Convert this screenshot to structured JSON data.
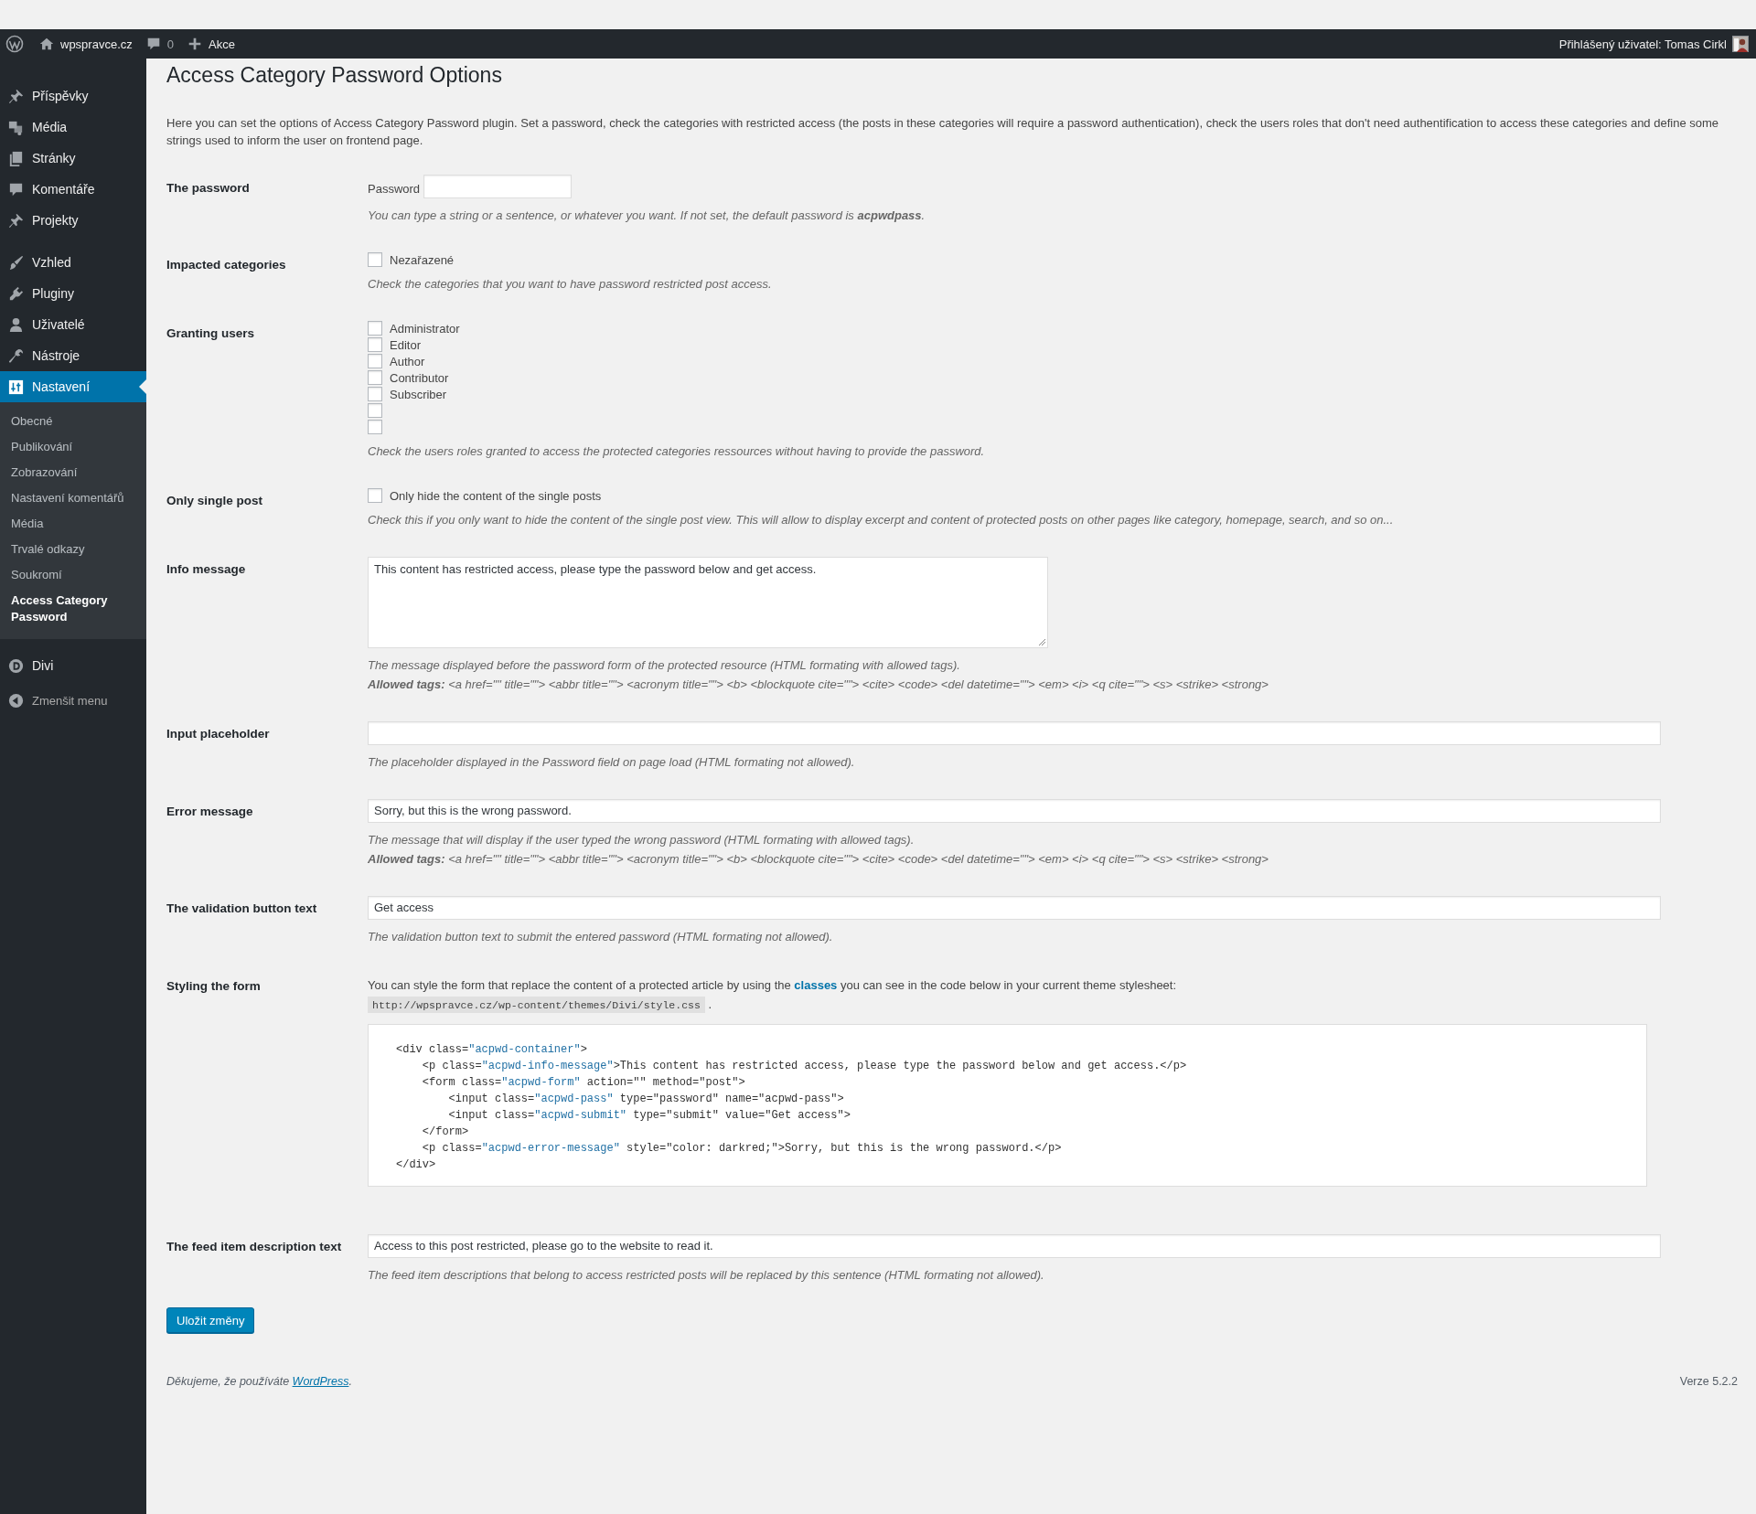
{
  "admin_bar": {
    "site": "wpspravce.cz",
    "comments": "0",
    "new": "Akce",
    "user": "Přihlášený uživatel: Tomas Cirkl"
  },
  "sidebar": {
    "groups": [
      [
        {
          "label": "Příspěvky",
          "kind": "pin",
          "selected": false
        },
        {
          "label": "Média",
          "kind": "media",
          "selected": false
        },
        {
          "label": "Stránky",
          "kind": "pages",
          "selected": false
        },
        {
          "label": "Komentáře",
          "kind": "comment",
          "selected": false
        },
        {
          "label": "Projekty",
          "kind": "pin",
          "selected": false
        }
      ],
      [
        {
          "label": "Vzhled",
          "kind": "brush",
          "selected": false
        },
        {
          "label": "Pluginy",
          "kind": "plug",
          "selected": false
        },
        {
          "label": "Uživatelé",
          "kind": "user",
          "selected": false
        },
        {
          "label": "Nástroje",
          "kind": "wrench",
          "selected": false
        },
        {
          "label": "Nastavení",
          "kind": "settings",
          "selected": true,
          "children": [
            {
              "label": "Obecné",
              "selected": false
            },
            {
              "label": "Publikování",
              "selected": false
            },
            {
              "label": "Zobrazování",
              "selected": false
            },
            {
              "label": "Nastavení komentářů",
              "selected": false
            },
            {
              "label": "Média",
              "selected": false
            },
            {
              "label": "Trvalé odkazy",
              "selected": false
            },
            {
              "label": "Soukromí",
              "selected": false
            },
            {
              "label": "Access Category Password",
              "selected": true
            }
          ]
        }
      ],
      [
        {
          "label": "Divi",
          "kind": "divi",
          "selected": false
        }
      ]
    ],
    "collapse": "Zmenšit menu"
  },
  "page": {
    "title": "Access Category Password Options",
    "intro": "Here you can set the options of Access Category Password plugin. Set a password, check the categories with restricted access (the posts in these categories will require a password authentication), check the users roles that don't need authentification to access these categories and define some strings used to inform the user on frontend page.",
    "fields": [
      {
        "kind": "password",
        "label": "The password",
        "field_label": "Password",
        "description": "You can type a string or a sentence, or whatever you want. If not set, the default password is **acpwdpass**."
      },
      {
        "kind": "checkboxes",
        "label": "Impacted categories",
        "options": [
          {
            "label": "Nezařazené",
            "checked": false
          }
        ],
        "description": "Check the categories that you want to have password restricted post access."
      },
      {
        "kind": "checkboxes",
        "label": "Granting users",
        "options": [
          {
            "label": "Administrator",
            "checked": false
          },
          {
            "label": "Editor",
            "checked": false
          },
          {
            "label": "Author",
            "checked": false
          },
          {
            "label": "Contributor",
            "checked": false
          },
          {
            "label": "Subscriber",
            "checked": false
          },
          {
            "checked": false
          },
          {
            "checked": false
          }
        ],
        "description": "Check the users roles granted to access the protected categories ressources without having to provide the password."
      },
      {
        "kind": "checkboxes",
        "label": "Only single post",
        "options": [
          {
            "label": "Only hide the content of the single posts",
            "checked": false
          }
        ],
        "description": "Check this if you only want to hide the content of the single post view. This will allow to display excerpt and content of protected posts on other pages like category, homepage, search, and so on..."
      },
      {
        "kind": "textarea",
        "label": "Info message",
        "value": "This content has restricted access, please type the password below and get access.",
        "description": "The message displayed before the password form of the protected resource (HTML formating with allowed tags).",
        "allowed_tags": "**Allowed tags:** <a href=\"\" title=\"\"> <abbr title=\"\"> <acronym title=\"\"> <b> <blockquote cite=\"\"> <cite> <code> <del datetime=\"\"> <em> <i> <q cite=\"\"> <s> <strike> <strong>"
      },
      {
        "kind": "text",
        "label": "Input placeholder",
        "description": "The placeholder displayed in the Password field on page load (HTML formating not allowed)."
      },
      {
        "kind": "text",
        "label": "Error message",
        "value": "Sorry, but this is the wrong password.",
        "description": "The message that will display if the user typed the wrong password (HTML formating with allowed tags).",
        "allowed_tags": "**Allowed tags:** <a href=\"\" title=\"\"> <abbr title=\"\"> <acronym title=\"\"> <b> <blockquote cite=\"\"> <cite> <code> <del datetime=\"\"> <em> <i> <q cite=\"\"> <s> <strike> <strong>"
      },
      {
        "kind": "text",
        "label": "The validation button text",
        "value": "Get access",
        "description": "The validation button text to submit the entered password (HTML formating not allowed)."
      },
      {
        "kind": "styling",
        "label": "Styling the form",
        "text_before": "You can style the form that replace the content of a protected article by using the ",
        "link": "classes",
        "text_after": " you can see in the code below in your current theme stylesheet:",
        "stylesheet_url": "http://wpspravce.cz/wp-content/themes/Divi/style.css",
        "url_suffix": " .",
        "code_lines": [
          [
            {
              "text": "<div class=",
              "kind": "plain"
            },
            {
              "text": "\"acpwd-container\"",
              "kind": "class"
            },
            {
              "text": ">",
              "kind": "plain"
            }
          ],
          [
            {
              "text": "    <p class=",
              "kind": "plain"
            },
            {
              "text": "\"acpwd-info-message\"",
              "kind": "class"
            },
            {
              "text": ">This content has restricted access, please type the password below and get access.</p>",
              "kind": "plain"
            }
          ],
          [
            {
              "text": "    <form class=",
              "kind": "plain"
            },
            {
              "text": "\"acpwd-form\"",
              "kind": "class"
            },
            {
              "text": " action=\"\" method=\"post\">",
              "kind": "plain"
            }
          ],
          [
            {
              "text": "        <input class=",
              "kind": "plain"
            },
            {
              "text": "\"acpwd-pass\"",
              "kind": "class"
            },
            {
              "text": " type=\"password\" name=\"acpwd-pass\">",
              "kind": "plain"
            }
          ],
          [
            {
              "text": "        <input class=",
              "kind": "plain"
            },
            {
              "text": "\"acpwd-submit\"",
              "kind": "class"
            },
            {
              "text": " type=\"submit\" value=\"Get access\">",
              "kind": "plain"
            }
          ],
          [
            {
              "text": "    </form>",
              "kind": "plain"
            }
          ],
          [
            {
              "text": "    <p class=",
              "kind": "plain"
            },
            {
              "text": "\"acpwd-error-message\"",
              "kind": "class"
            },
            {
              "text": " style=\"color: darkred;\">Sorry, but this is the wrong password.</p>",
              "kind": "plain"
            }
          ],
          [
            {
              "text": "</div>",
              "kind": "plain"
            }
          ]
        ]
      },
      {
        "kind": "text",
        "label": "The feed item description text",
        "value": "Access to this post restricted, please go to the website to read it.",
        "description": "The feed item descriptions that belong to access restricted posts will be replaced by this sentence (HTML formating not allowed)."
      }
    ],
    "save_button": "Uložit změny"
  },
  "footer": {
    "thanks": "Děkujeme, že používáte ",
    "link": "WordPress",
    "thanks_end": ".",
    "version": "Verze 5.2.2"
  }
}
